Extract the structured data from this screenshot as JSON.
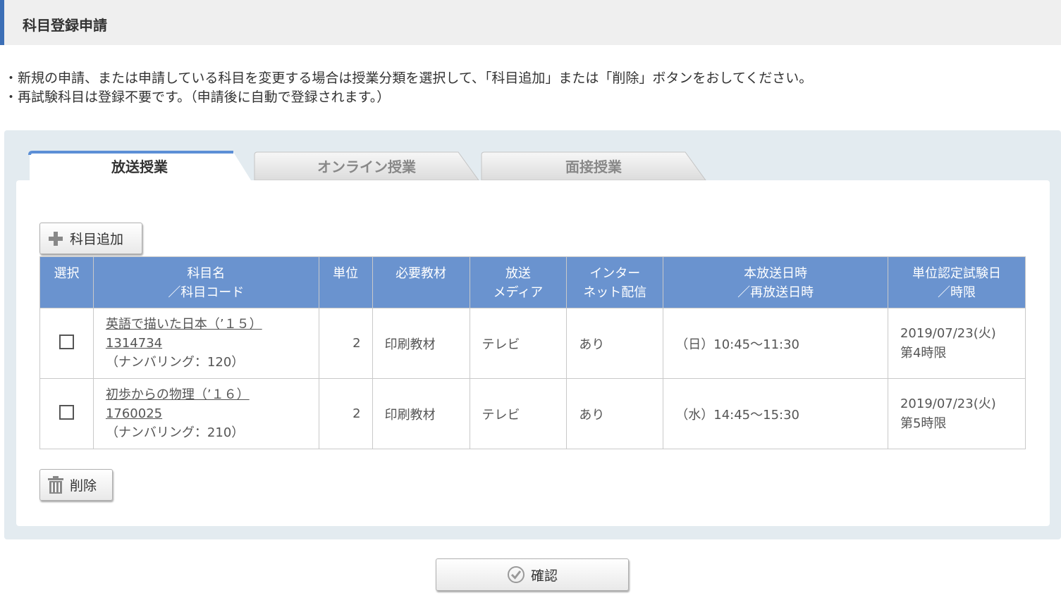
{
  "header": {
    "title": "科目登録申請"
  },
  "notes": [
    "・新規の申請、または申請している科目を変更する場合は授業分類を選択して、「科目追加」または「削除」ボタンをおしてください。",
    "・再試験科目は登録不要です。（申請後に自動で登録されます。）"
  ],
  "tabs": [
    {
      "label": "放送授業",
      "active": true
    },
    {
      "label": "オンライン授業",
      "active": false
    },
    {
      "label": "面接授業",
      "active": false
    }
  ],
  "buttons": {
    "add_label": "科目追加",
    "delete_label": "削除",
    "confirm_label": "確認"
  },
  "table": {
    "headers": [
      {
        "line1": "選択",
        "line2": ""
      },
      {
        "line1": "科目名",
        "line2": "／科目コード"
      },
      {
        "line1": "単位",
        "line2": ""
      },
      {
        "line1": "必要教材",
        "line2": ""
      },
      {
        "line1": "放送",
        "line2": "メディア"
      },
      {
        "line1": "インター",
        "line2": "ネット配信"
      },
      {
        "line1": "本放送日時",
        "line2": "／再放送日時"
      },
      {
        "line1": "単位認定試験日",
        "line2": "／時限"
      }
    ],
    "rows": [
      {
        "checked": false,
        "name": "英語で描いた日本（’１５）",
        "code": "1314734",
        "numbering": "（ナンバリング：120）",
        "units": "2",
        "material": "印刷教材",
        "media": "テレビ",
        "internet": "あり",
        "broadcast": "（日）10:45～11:30",
        "exam_date": "2019/07/23(火)",
        "exam_period": "第4時限"
      },
      {
        "checked": false,
        "name": "初歩からの物理（’１６）",
        "code": "1760025",
        "numbering": "（ナンバリング：210）",
        "units": "2",
        "material": "印刷教材",
        "media": "テレビ",
        "internet": "あり",
        "broadcast": "（水）14:45～15:30",
        "exam_date": "2019/07/23(火)",
        "exam_period": "第5時限"
      }
    ]
  },
  "colors": {
    "accent": "#3c6fb6",
    "table_header": "#6a93cf",
    "panel": "#e3ebf0"
  },
  "icons": {
    "add": "plus-icon",
    "delete": "trash-icon",
    "confirm": "check-circle-icon"
  }
}
